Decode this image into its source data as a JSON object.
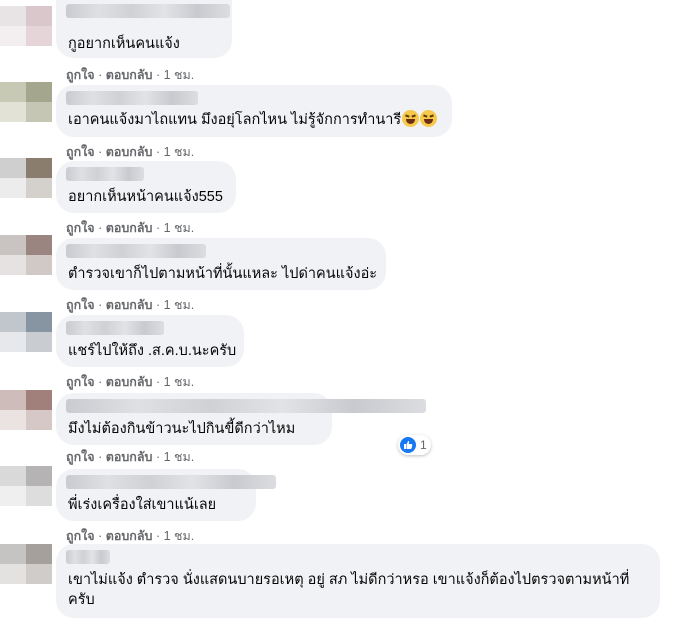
{
  "comments": [
    {
      "text": "กูอยากเห็นคนแจ้ง",
      "action_like": "ถูกใจ",
      "action_reply": "ตอบกลับ",
      "time": "1 ชม."
    },
    {
      "text": "เอาคนแจ้งมาไถแทน มึงอยุ่โลกไหน ไม่รู้จักการทำนารี",
      "action_like": "ถูกใจ",
      "action_reply": "ตอบกลับ",
      "time": "1 ชม."
    },
    {
      "text": "อยากเห็นหน้าคนแจ้ง555",
      "action_like": "ถูกใจ",
      "action_reply": "ตอบกลับ",
      "time": "1 ชม."
    },
    {
      "text": "ตำรวจเขาก็ไปตามหน้าที่นั้นแหละ ไปด่าคนแจ้งอ่ะ",
      "action_like": "ถูกใจ",
      "action_reply": "ตอบกลับ",
      "time": "1 ชม."
    },
    {
      "text": "แชร์ไปให้ถึง .ส.ค.บ.นะครับ",
      "action_like": "ถูกใจ",
      "action_reply": "ตอบกลับ",
      "time": "1 ชม."
    },
    {
      "text": "มึงไม่ต้องกินข้าวนะไปกินขี้ดีกว่าไหม",
      "action_like": "ถูกใจ",
      "action_reply": "ตอบกลับ",
      "time": "1 ชม.",
      "reactions": "1"
    },
    {
      "text": "พี่เร่งเครื่องใส่เขาแน้เลย",
      "action_like": "ถูกใจ",
      "action_reply": "ตอบกลับ",
      "time": "1 ชม."
    },
    {
      "text": "เขาไม่แจ้ง ตำรวจ นั่งแสดนบายรอเหตุ อยู่ สภ ไม่ดีกว่าหรอ เขาแจ้งก็ต้องไปตรวจตามหน้าที่ครับ"
    }
  ],
  "separator": "·"
}
